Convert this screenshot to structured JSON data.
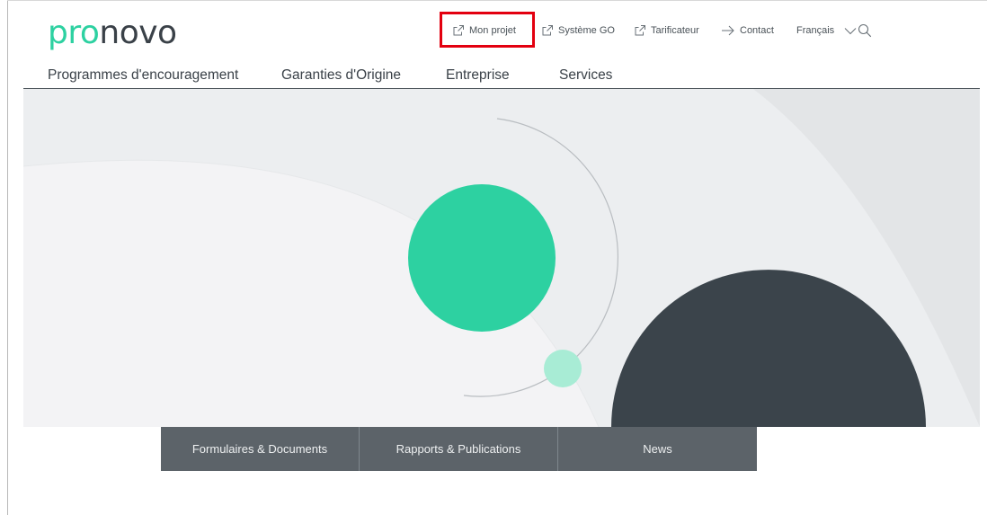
{
  "logo": {
    "pro": "pro",
    "novo": "novo"
  },
  "utility_nav": [
    {
      "label": "Mon projet",
      "icon": "external-link-icon",
      "highlighted": true
    },
    {
      "label": "Système GO",
      "icon": "external-link-icon"
    },
    {
      "label": "Tarificateur",
      "icon": "external-link-icon"
    },
    {
      "label": "Contact",
      "icon": "arrow-right-icon"
    },
    {
      "label": "Français",
      "icon": "chevron-down-icon"
    }
  ],
  "main_nav": [
    "Programmes d'encouragement",
    "Garanties d'Origine",
    "Entreprise",
    "Services"
  ],
  "tabs": [
    "Formulaires & Documents",
    "Rapports & Publications",
    "News"
  ],
  "colors": {
    "accent": "#2dd1a1",
    "dark": "#3a4148",
    "tab_bg": "#5c6369",
    "highlight": "#e3000f"
  }
}
